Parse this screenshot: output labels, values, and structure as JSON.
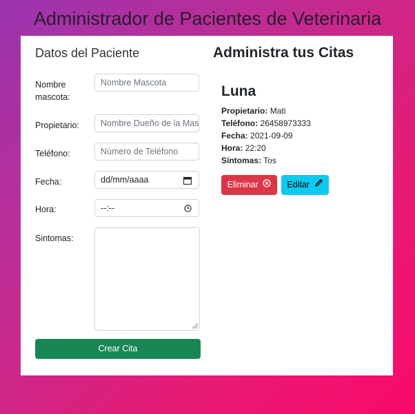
{
  "header": {
    "title": "Administrador de Pacientes de Veterinaria"
  },
  "form": {
    "title": "Datos del Paciente",
    "fields": [
      {
        "label": "Nombre mascota:",
        "placeholder": "Nombre Mascota"
      },
      {
        "label": "Propietario:",
        "placeholder": "Nombre Dueño de la Mascota"
      },
      {
        "label": "Teléfono:",
        "placeholder": "Número de Teléfono"
      },
      {
        "label": "Fecha:",
        "value": "dd/mm/aaaa",
        "icon": "calendar-icon"
      },
      {
        "label": "Hora:",
        "value": "--:--",
        "icon": "clock-icon"
      },
      {
        "label": "Sintomas:",
        "value": ""
      }
    ],
    "submit_label": "Crear Cita"
  },
  "appointments": {
    "title": "Administra tus Citas",
    "items": [
      {
        "pet_name": "Luna",
        "owner_label": "Propietario:",
        "owner": "Mati",
        "phone_label": "Teléfono:",
        "phone": "26458973333",
        "date_label": "Fecha:",
        "date": "2021-09-09",
        "time_label": "Hora:",
        "time": "22:20",
        "symptoms_label": "Síntomas:",
        "symptoms": "Tos",
        "delete_label": "Eliminar",
        "edit_label": "Editar"
      }
    ]
  },
  "colors": {
    "create": "#198754",
    "delete": "#dc3545",
    "edit": "#0dcaf0"
  }
}
